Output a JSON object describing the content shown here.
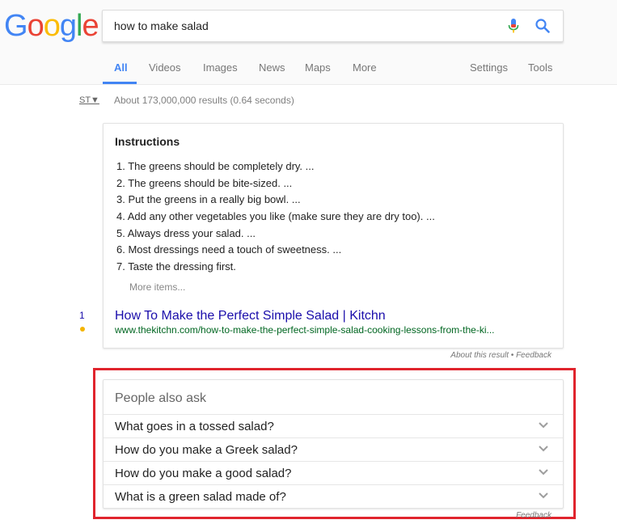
{
  "logo": {
    "letters": [
      {
        "char": "G",
        "color": "#4285f4"
      },
      {
        "char": "o",
        "color": "#ea4335"
      },
      {
        "char": "o",
        "color": "#fbbc05"
      },
      {
        "char": "g",
        "color": "#4285f4"
      },
      {
        "char": "l",
        "color": "#34a853"
      },
      {
        "char": "e",
        "color": "#ea4335"
      }
    ]
  },
  "search": {
    "query": "how to make salad",
    "mic_icon": "microphone-icon",
    "search_icon": "search-icon"
  },
  "tabs": [
    {
      "label": "All",
      "active": true
    },
    {
      "label": "Videos"
    },
    {
      "label": "Images"
    },
    {
      "label": "News"
    },
    {
      "label": "Maps"
    },
    {
      "label": "More"
    },
    {
      "label": "Settings"
    },
    {
      "label": "Tools"
    }
  ],
  "toolbar": {
    "st_label": "ST▼",
    "result_stats": "About 173,000,000 results (0.64 seconds)"
  },
  "snippet": {
    "title": "Instructions",
    "steps": [
      "1. The greens should be completely dry. ...",
      "2. The greens should be bite-sized. ...",
      "3. Put the greens in a really big bowl. ...",
      "4. Add any other vegetables you like (make sure they are dry too). ...",
      "5. Always dress your salad. ...",
      "6. Most dressings need a touch of sweetness. ...",
      "7. Taste the dressing first."
    ],
    "more_items": "More items...",
    "result_title": "How To Make the Perfect Simple Salad | Kitchn",
    "result_url": "www.thekitchn.com/how-to-make-the-perfect-simple-salad-cooking-lessons-from-the-ki...",
    "rank": "1",
    "about_label": "About this result",
    "separator": " • ",
    "feedback_label": "Feedback"
  },
  "people_also_ask": {
    "title": "People also ask",
    "questions": [
      "What goes in a tossed salad?",
      "How do you make a Greek salad?",
      "How do you make a good salad?",
      "What is a green salad made of?"
    ],
    "feedback_label": "Feedback"
  },
  "colors": {
    "accent": "#4285f4",
    "link": "#1a0dab",
    "url": "#006621",
    "highlight": "#e0242d"
  }
}
